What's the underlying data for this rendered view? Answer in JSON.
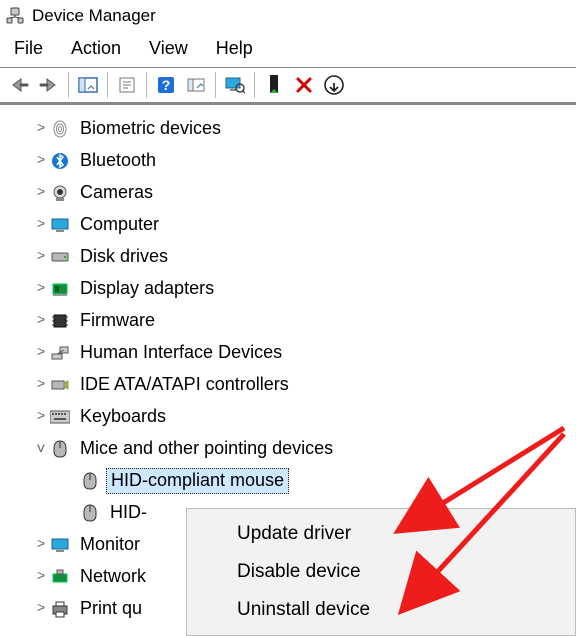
{
  "window": {
    "title": "Device Manager"
  },
  "menu": {
    "file": "File",
    "action": "Action",
    "view": "View",
    "help": "Help"
  },
  "tree": {
    "biometric": "Biometric devices",
    "bluetooth": "Bluetooth",
    "cameras": "Cameras",
    "computer": "Computer",
    "disk": "Disk drives",
    "display": "Display adapters",
    "firmware": "Firmware",
    "hid": "Human Interface Devices",
    "ide": "IDE ATA/ATAPI controllers",
    "keyboards": "Keyboards",
    "mice": "Mice and other pointing devices",
    "mice_children": {
      "hid1": "HID-compliant mouse",
      "hid2_partial": "HID-"
    },
    "monitors_partial": "Monitor",
    "network_partial": "Network",
    "print_partial": "Print qu"
  },
  "context": {
    "update": "Update driver",
    "disable": "Disable device",
    "uninstall": "Uninstall device"
  },
  "glyph": {
    "collapsed": ">",
    "expanded": "v"
  }
}
